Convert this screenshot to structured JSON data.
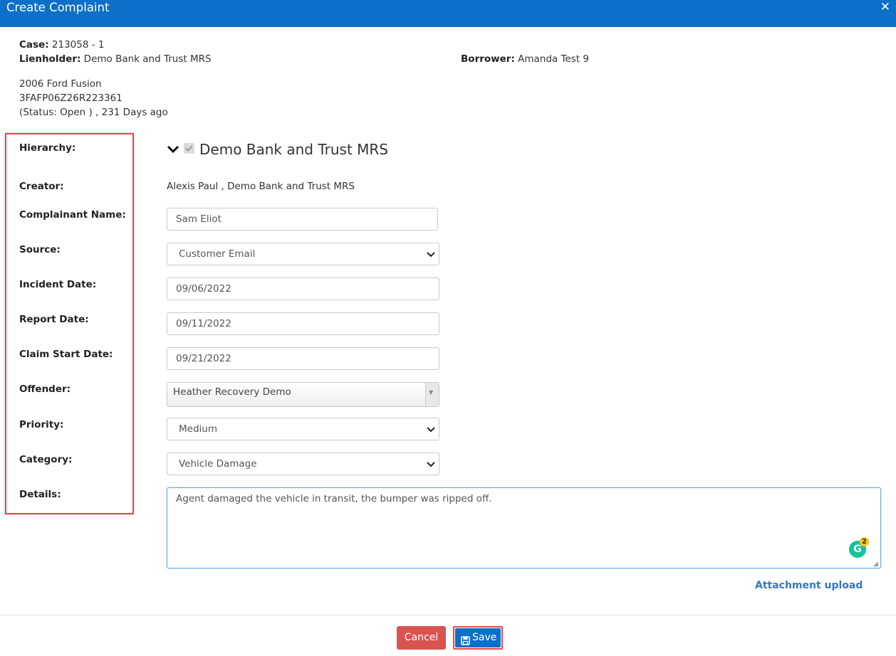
{
  "header": {
    "title": "Create Complaint",
    "close_icon": "close-icon"
  },
  "case_info": {
    "case_label": "Case:",
    "case_value": " 213058 - 1",
    "lienholder_label": "Lienholder:",
    "lienholder_value": " Demo Bank and Trust MRS",
    "borrower_label": "Borrower:",
    "borrower_value": " Amanda Test 9",
    "vehicle": "2006 Ford Fusion",
    "vin": "3FAFP06Z26R223361",
    "status": "(Status: Open ) , 231 Days ago"
  },
  "labels": {
    "hierarchy": "Hierarchy:",
    "creator": "Creator:",
    "complainant_name": "Complainant Name:",
    "source": "Source:",
    "incident_date": "Incident Date:",
    "report_date": "Report Date:",
    "claim_start_date": "Claim Start Date:",
    "offender": "Offender:",
    "priority": "Priority:",
    "category": "Category:",
    "details": "Details:"
  },
  "form": {
    "hierarchy": {
      "name": "Demo Bank and Trust MRS",
      "checked": true,
      "expand_icon": "chevron-down-icon"
    },
    "creator": "Alexis Paul , Demo Bank and Trust MRS",
    "complainant_name": "Sam Eliot",
    "source": "Customer Email",
    "incident_date": "09/06/2022",
    "report_date": "09/11/2022",
    "claim_start_date": "09/21/2022",
    "offender": "Heather Recovery Demo",
    "priority": "Medium",
    "category": "Vehicle Damage",
    "details": "Agent damaged the vehicle in transit, the bumper was ripped off.",
    "grammarly_count": "2"
  },
  "actions": {
    "attachment_upload": "Attachment upload",
    "cancel": "Cancel",
    "save": "Save",
    "save_icon": "floppy-disk-icon"
  },
  "colors": {
    "header_bg": "#0c70c8",
    "highlight_border": "#e8464b",
    "cancel_bg": "#d9534f",
    "save_bg": "#0c70c8",
    "link": "#3479c1"
  }
}
